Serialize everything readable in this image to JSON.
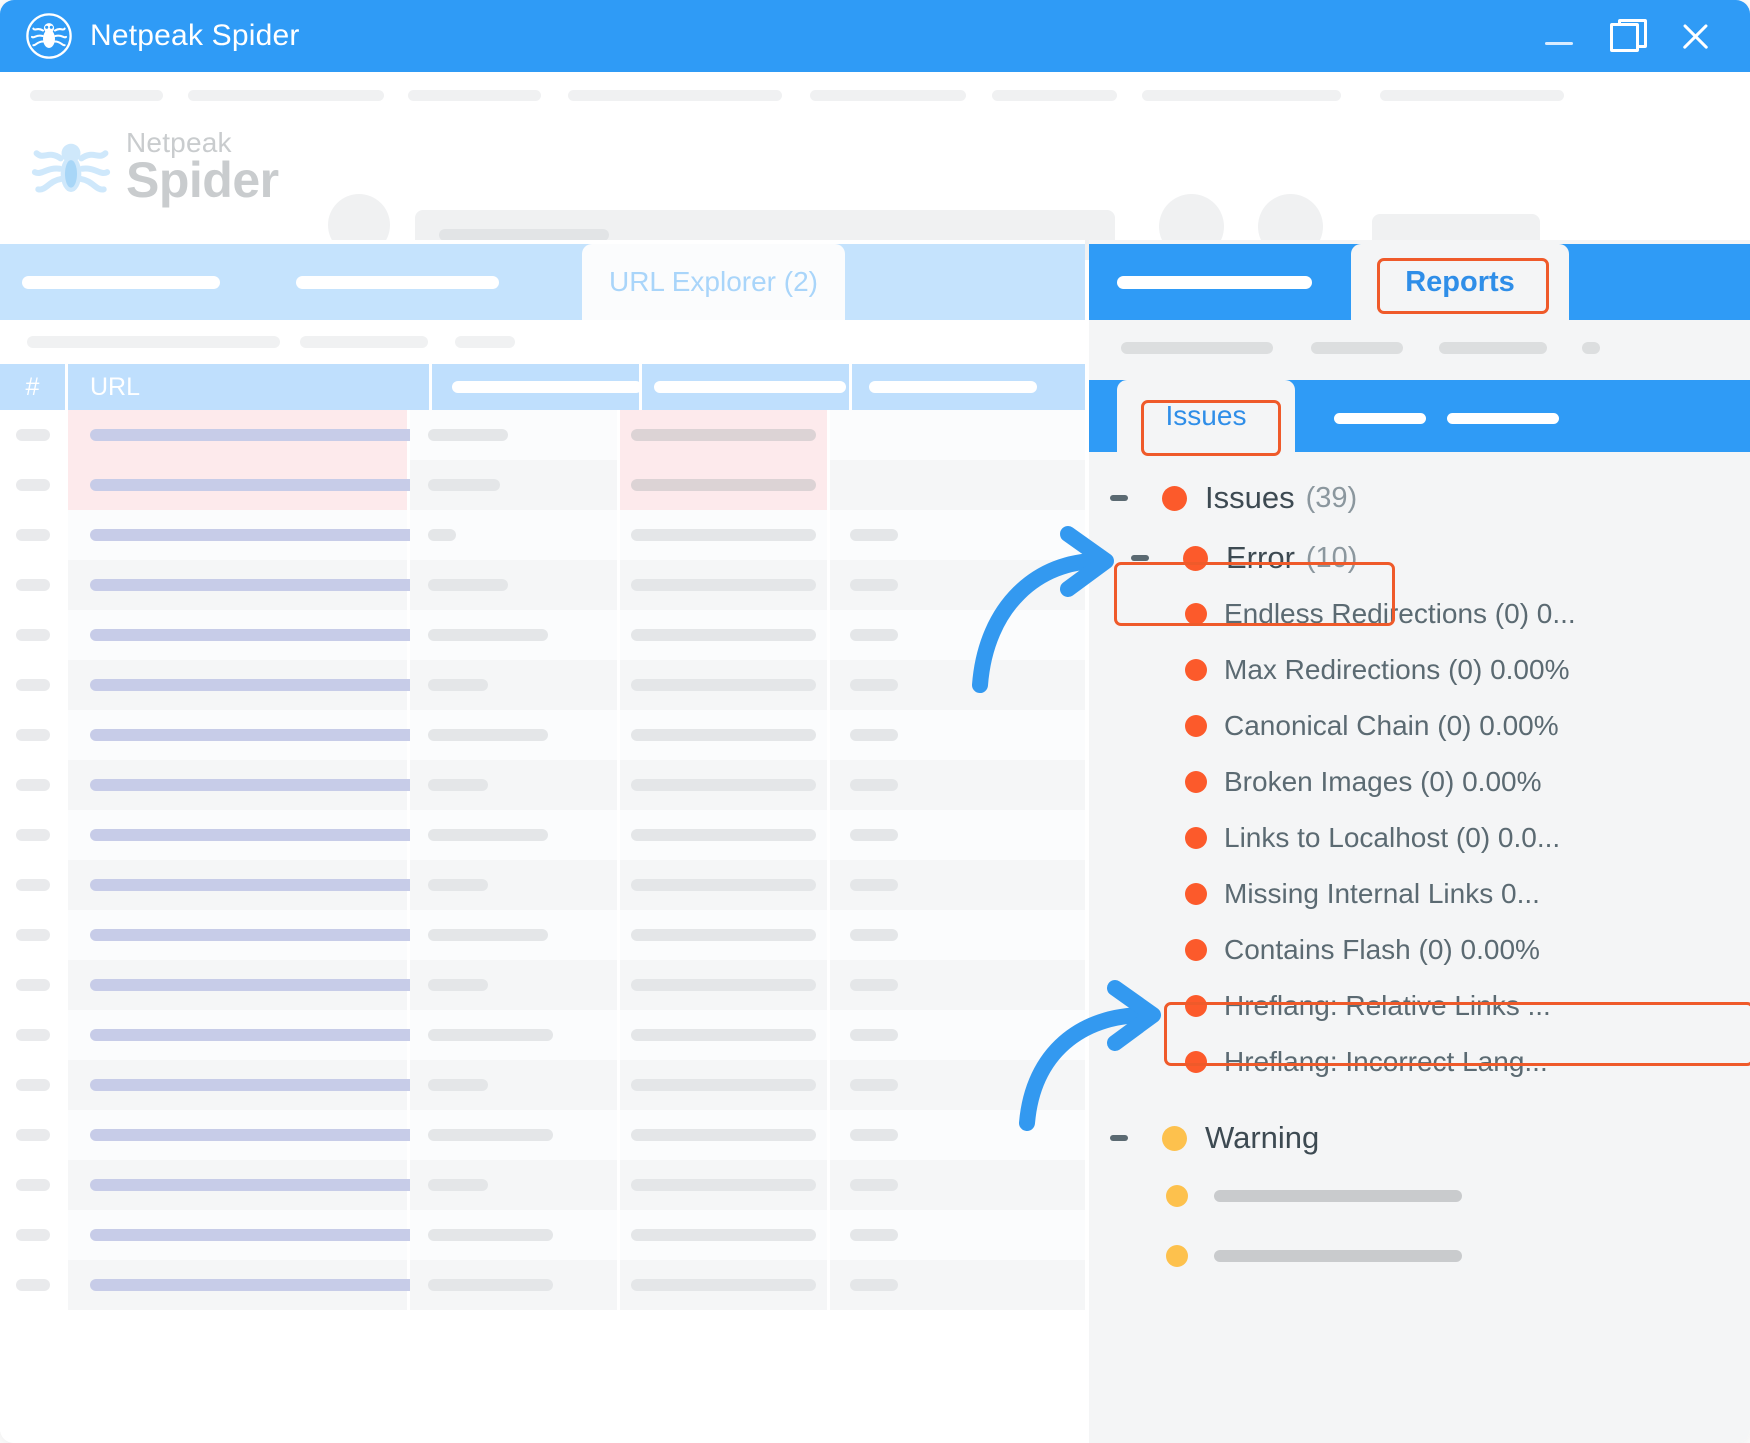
{
  "window": {
    "title": "Netpeak Spider",
    "logo_icon": "spider-logo-icon",
    "controls": {
      "minimize": "minimize-icon",
      "maximize": "restore-icon",
      "close": "close-icon"
    }
  },
  "brand": {
    "top": "Netpeak",
    "bottom": "Spider",
    "mark_icon": "spider-mark-icon"
  },
  "main_pane": {
    "active_tab": "URL Explorer (2)",
    "table": {
      "columns": [
        "#",
        "URL",
        "",
        "",
        ""
      ],
      "rows": 18
    }
  },
  "right_pane": {
    "tabs": {
      "active": "Reports"
    },
    "subtabs": {
      "active": "Issues"
    },
    "tree": {
      "root": {
        "label": "Issues",
        "count": "(39)",
        "severity": "error",
        "expanded": true
      },
      "error_group": {
        "label": "Error",
        "count": "(10)",
        "severity": "error",
        "expanded": true,
        "highlighted": true
      },
      "error_items": [
        {
          "label": "Endless Redirections (0) 0...",
          "severity": "error"
        },
        {
          "label": "Max Redirections (0) 0.00%",
          "severity": "error"
        },
        {
          "label": "Canonical Chain (0) 0.00%",
          "severity": "error"
        },
        {
          "label": "Broken Images (0) 0.00%",
          "severity": "error"
        },
        {
          "label": "Links to Localhost (0) 0.0...",
          "severity": "error"
        },
        {
          "label": "Missing Internal Links 0...",
          "severity": "error"
        },
        {
          "label": "Contains Flash (0) 0.00%",
          "severity": "error"
        },
        {
          "label": "Hreflang: Relative Links ...",
          "severity": "error",
          "highlighted": true
        },
        {
          "label": "Hreflang: Incorrect  Lang...",
          "severity": "error"
        }
      ],
      "warning_group": {
        "label": "Warning",
        "severity": "warning",
        "expanded": true
      },
      "warning_items": [
        {
          "label": "",
          "severity": "warning"
        },
        {
          "label": "",
          "severity": "warning"
        }
      ]
    }
  },
  "colors": {
    "brand_blue": "#2f9bf6",
    "tab_blue_light": "#c5e3fd",
    "highlight_orange": "#ef5a2a",
    "error_dot": "#fc5a2b",
    "warning_dot": "#fdc14d",
    "arrow_blue": "#3399f0",
    "row_pink": "#fdeaec",
    "url_bar": "#c7cce8"
  },
  "annotations": {
    "arrow_to_error": "arrow-icon",
    "arrow_to_hreflang": "arrow-icon"
  }
}
